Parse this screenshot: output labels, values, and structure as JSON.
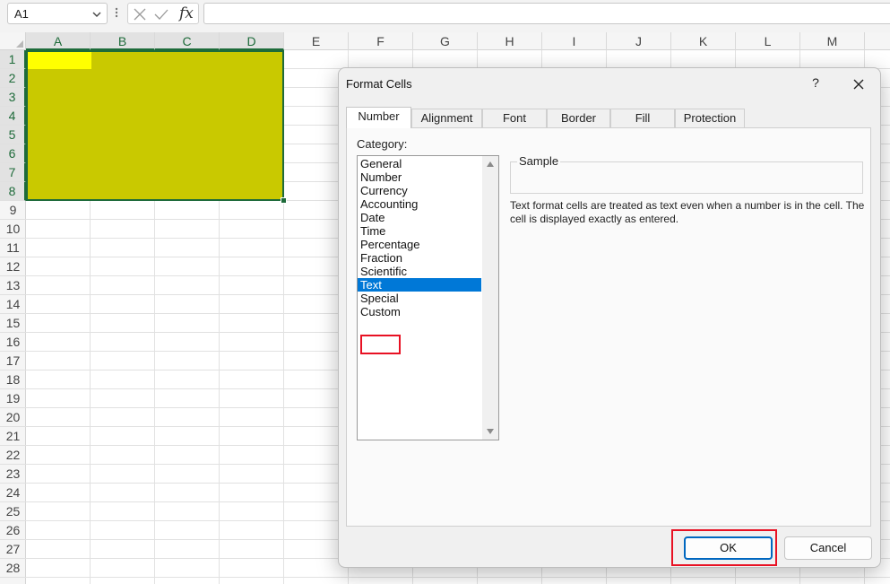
{
  "formula_bar": {
    "name_box_value": "A1",
    "icons": [
      "chevron-down-icon",
      "more-icon",
      "cancel-icon",
      "enter-icon"
    ],
    "fx_label": "fx",
    "formula_value": ""
  },
  "sheet": {
    "columns": [
      "A",
      "B",
      "C",
      "D",
      "E",
      "F",
      "G",
      "H",
      "I",
      "J",
      "K",
      "L",
      "M"
    ],
    "rows": [
      "1",
      "2",
      "3",
      "4",
      "5",
      "6",
      "7",
      "8",
      "9",
      "10",
      "11",
      "12",
      "13",
      "14",
      "15",
      "16",
      "17",
      "18",
      "19",
      "20",
      "21",
      "22",
      "23",
      "24",
      "25",
      "26",
      "27",
      "28"
    ],
    "selected_range": "A1:D8",
    "colors": {
      "selection_fill": "#c9c900",
      "active_cell_fill": "#ffff00",
      "selection_border": "#1e6b3a"
    }
  },
  "dialog": {
    "title": "Format Cells",
    "help_label": "?",
    "tabs": [
      "Number",
      "Alignment",
      "Font",
      "Border",
      "Fill",
      "Protection"
    ],
    "active_tab": "Number",
    "category_label": "Category:",
    "categories": [
      "General",
      "Number",
      "Currency",
      "Accounting",
      "Date",
      "Time",
      "Percentage",
      "Fraction",
      "Scientific",
      "Text",
      "Special",
      "Custom"
    ],
    "selected_category": "Text",
    "sample_label": "Sample",
    "description": "Text format cells are treated as text even when a number is in the cell.  The cell is displayed exactly as entered.",
    "ok_label": "OK",
    "cancel_label": "Cancel",
    "colors": {
      "highlight_box": "#e81123",
      "list_selection": "#0078d7",
      "primary_border": "#0067c0"
    }
  }
}
